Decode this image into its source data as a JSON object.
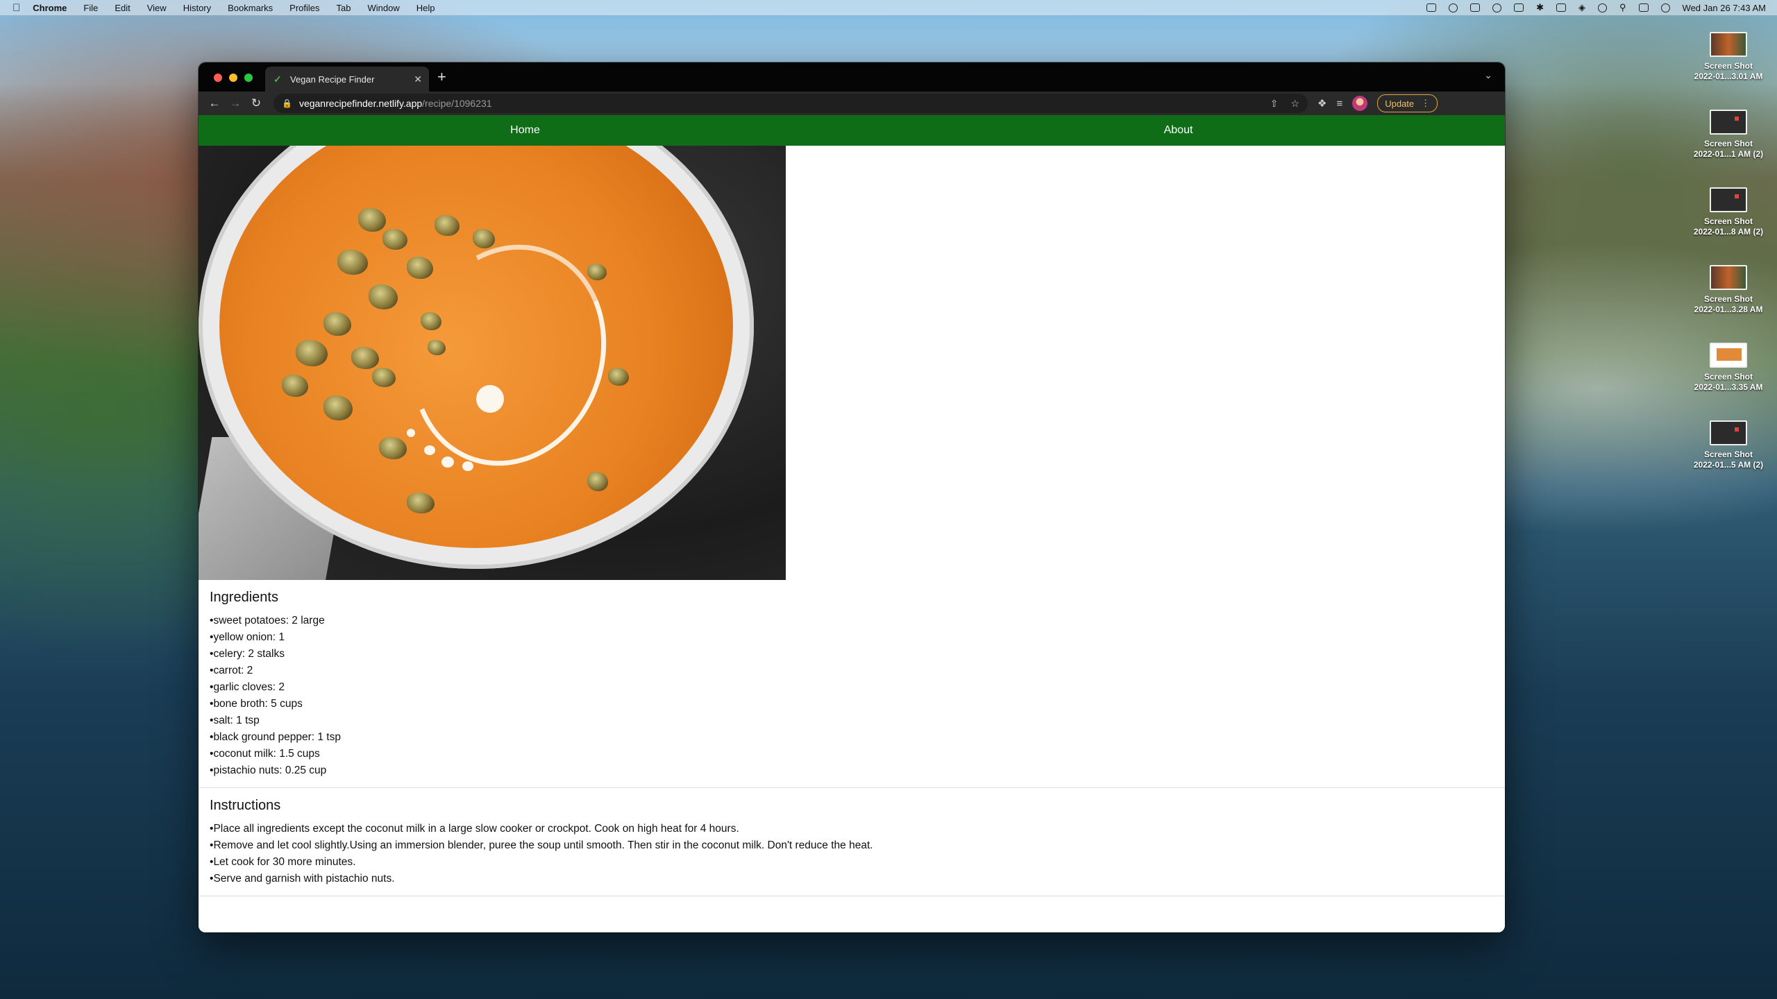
{
  "menubar": {
    "app": "Chrome",
    "items": [
      "File",
      "Edit",
      "View",
      "History",
      "Bookmarks",
      "Profiles",
      "Tab",
      "Window",
      "Help"
    ],
    "clock": "Wed Jan 26  7:43 AM"
  },
  "desktop": {
    "icons": [
      {
        "line1": "Screen Shot",
        "line2": "2022-01...3.01 AM",
        "thumb": "img1"
      },
      {
        "line1": "Screen Shot",
        "line2": "2022-01...1 AM (2)",
        "thumb": "dark"
      },
      {
        "line1": "Screen Shot",
        "line2": "2022-01...8 AM (2)",
        "thumb": "dark"
      },
      {
        "line1": "Screen Shot",
        "line2": "2022-01...3.28 AM",
        "thumb": "img1"
      },
      {
        "line1": "Screen Shot",
        "line2": "2022-01...3.35 AM",
        "thumb": "img2"
      },
      {
        "line1": "Screen Shot",
        "line2": "2022-01...5 AM (2)",
        "thumb": "dark"
      }
    ]
  },
  "browser": {
    "tab_title": "Vegan Recipe Finder",
    "url_host": "veganrecipefinder.netlify.app",
    "url_path": "/recipe/1096231",
    "update_label": "Update"
  },
  "site": {
    "nav": {
      "home": "Home",
      "about": "About"
    },
    "ingredients_title": "Ingredients",
    "ingredients": [
      "sweet potatoes: 2 large",
      "yellow onion: 1",
      "celery: 2 stalks",
      "carrot: 2",
      "garlic cloves: 2",
      "bone broth: 5 cups",
      "salt: 1 tsp",
      "black ground pepper: 1 tsp",
      "coconut milk: 1.5 cups",
      "pistachio nuts: 0.25 cup"
    ],
    "instructions_title": "Instructions",
    "instructions": [
      "Place all ingredients except the coconut milk in a large slow cooker or crockpot. Cook on high heat for 4 hours.",
      "Remove and let cool slightly.Using an immersion blender, puree the soup until smooth. Then stir in the coconut milk. Don't reduce the heat.",
      "Let cook for 30 more minutes.",
      "Serve and garnish with pistachio nuts."
    ]
  },
  "colors": {
    "navbar": "#0f6d17",
    "update_accent": "#e0a93a"
  }
}
